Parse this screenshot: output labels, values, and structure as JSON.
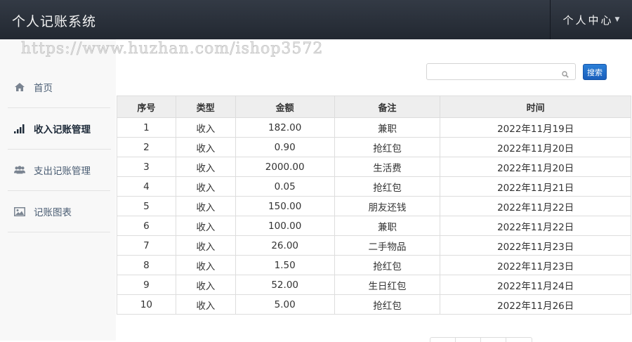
{
  "app": {
    "title": "个人记账系统"
  },
  "user_menu": {
    "label": "个人中心"
  },
  "watermark": "https://www.huzhan.com/ishop3572",
  "sidebar": {
    "items": [
      {
        "label": "首页",
        "icon": "home-icon",
        "active": false
      },
      {
        "label": "收入记账管理",
        "icon": "bar-chart-icon",
        "active": true
      },
      {
        "label": "支出记账管理",
        "icon": "users-icon",
        "active": false
      },
      {
        "label": "记账图表",
        "icon": "image-icon",
        "active": false
      }
    ]
  },
  "search": {
    "placeholder": "",
    "button": "搜索"
  },
  "table": {
    "headers": [
      "序号",
      "类型",
      "金额",
      "备注",
      "时间"
    ],
    "rows": [
      [
        "1",
        "收入",
        "182.00",
        "兼职",
        "2022年11月19日"
      ],
      [
        "2",
        "收入",
        "0.90",
        "抢红包",
        "2022年11月20日"
      ],
      [
        "3",
        "收入",
        "2000.00",
        "生活费",
        "2022年11月20日"
      ],
      [
        "4",
        "收入",
        "0.05",
        "抢红包",
        "2022年11月21日"
      ],
      [
        "5",
        "收入",
        "150.00",
        "朋友还钱",
        "2022年11月22日"
      ],
      [
        "6",
        "收入",
        "100.00",
        "兼职",
        "2022年11月22日"
      ],
      [
        "7",
        "收入",
        "26.00",
        "二手物品",
        "2022年11月23日"
      ],
      [
        "8",
        "收入",
        "1.50",
        "抢红包",
        "2022年11月23日"
      ],
      [
        "9",
        "收入",
        "52.00",
        "生日红包",
        "2022年11月24日"
      ],
      [
        "10",
        "收入",
        "5.00",
        "抢红包",
        "2022年11月26日"
      ]
    ]
  },
  "colors": {
    "navbar": "#2b313b",
    "accent": "#1f6fcf",
    "sidebar_bg": "#f8f8f8"
  }
}
